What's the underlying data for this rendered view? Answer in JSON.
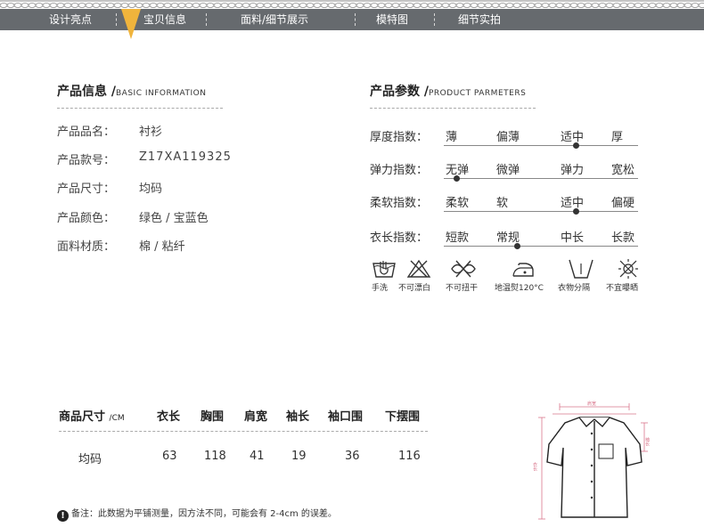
{
  "nav": {
    "items": [
      "设计亮点",
      "宝贝信息",
      "面料/细节展示",
      "模特图",
      "细节实拍"
    ],
    "active_index": 1
  },
  "info": {
    "title": "产品信息",
    "title_en": "BASIC INFORMATION",
    "rows": [
      {
        "label": "产品品名：",
        "value": "衬衫"
      },
      {
        "label": "产品款号：",
        "value": "Z17XA119325"
      },
      {
        "label": "产品尺寸：",
        "value": "均码"
      },
      {
        "label": "产品颜色：",
        "value": "绿色 / 宝蓝色"
      },
      {
        "label": "面料材质：",
        "value": "棉 / 粘纤"
      }
    ]
  },
  "params": {
    "title": "产品参数",
    "title_en": "PRODUCT PARMETERS",
    "rows": [
      {
        "label": "厚度指数：",
        "options": [
          "薄",
          "偏薄",
          "适中",
          "厚"
        ],
        "selected": 2
      },
      {
        "label": "弹力指数：",
        "options": [
          "无弹",
          "微弹",
          "弹力",
          "宽松"
        ],
        "selected": 0
      },
      {
        "label": "柔软指数：",
        "options": [
          "柔软",
          "软",
          "适中",
          "偏硬"
        ],
        "selected": 2
      },
      {
        "label": "衣长指数：",
        "options": [
          "短款",
          "常规",
          "中长",
          "长款"
        ],
        "selected": 1
      }
    ]
  },
  "care": [
    {
      "icon": "hand-wash-icon",
      "label": "手洗"
    },
    {
      "icon": "no-bleach-icon",
      "label": "不可漂白"
    },
    {
      "icon": "no-wring-icon",
      "label": "不可扭干"
    },
    {
      "icon": "low-iron-icon",
      "label": "地温熨120°C"
    },
    {
      "icon": "wash-separately-icon",
      "label": "衣物分隔"
    },
    {
      "icon": "no-sun-icon",
      "label": "不宜曝晒"
    }
  ],
  "sizes": {
    "title": "商品尺寸",
    "unit": "/CM",
    "headers": [
      "衣长",
      "胸围",
      "肩宽",
      "袖长",
      "袖口围",
      "下摆围"
    ],
    "rows": [
      {
        "size": "均码",
        "values": [
          "63",
          "118",
          "41",
          "19",
          "36",
          "116"
        ]
      }
    ]
  },
  "diagram": {
    "top_label": "肩宽",
    "side_label": "衣长",
    "right_label": "袖长"
  },
  "note": "备注：此数据为平铺测量，因方法不同，可能会有 2-4cm 的误差。",
  "colors": {
    "nav_bg": "#666a6e",
    "nav_marker": "#f0b43c",
    "diagram_lines": "#d9768c"
  }
}
